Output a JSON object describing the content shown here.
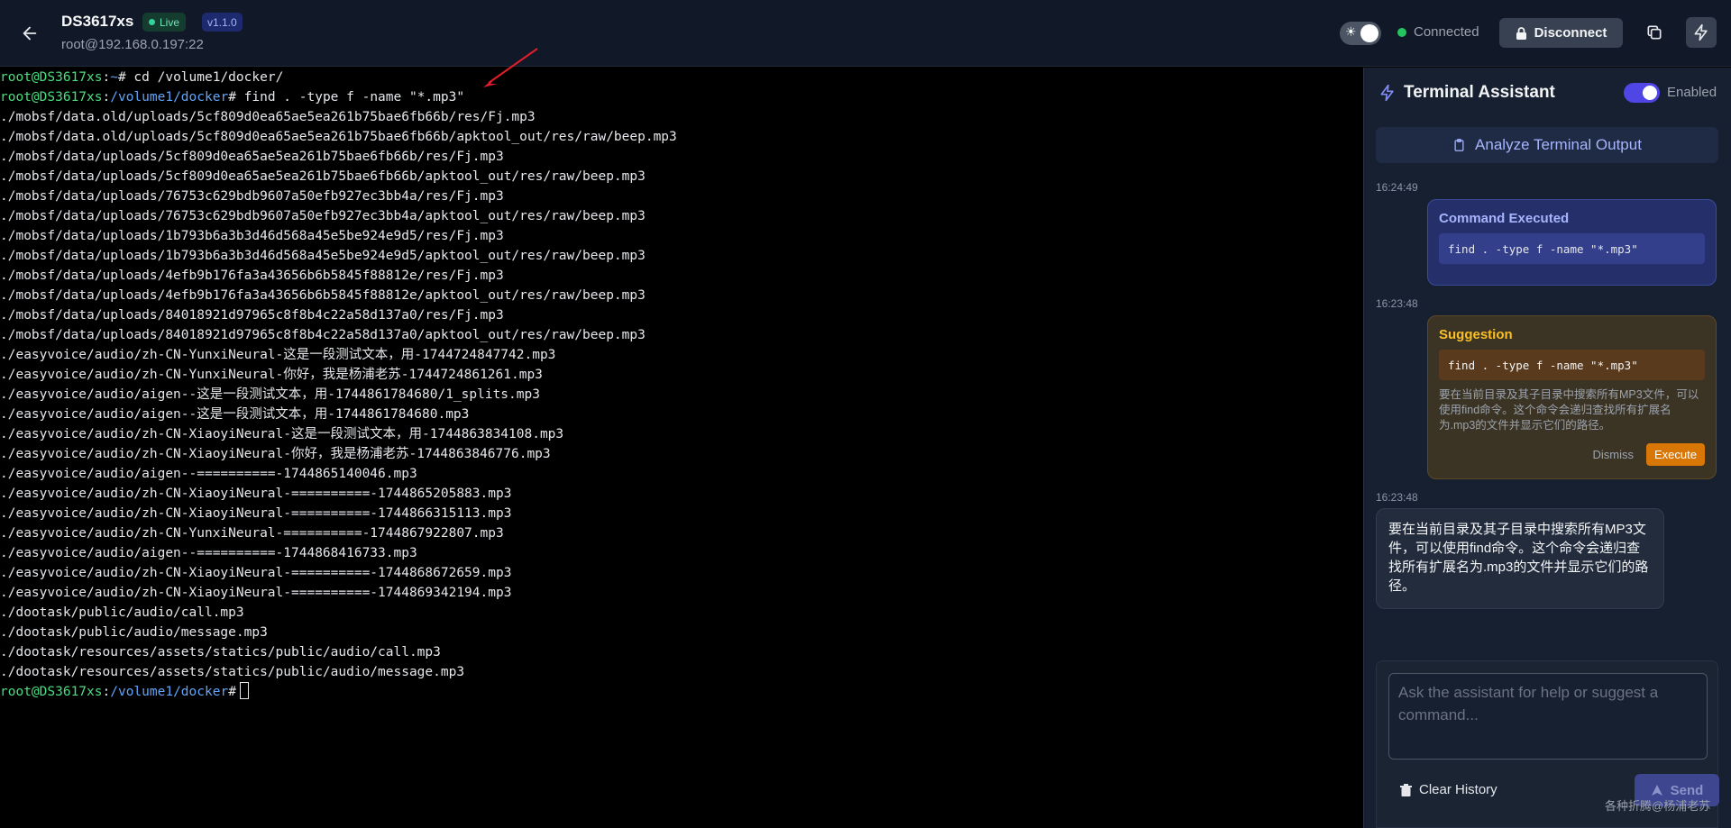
{
  "header": {
    "back_icon": "arrow-left-icon",
    "title": "DS3617xs",
    "live_label": "Live",
    "version": "v1.1.0",
    "subtitle": "root@192.168.0.197:22",
    "theme_icon": "sun-icon",
    "status": "Connected",
    "status_color": "#22c55e",
    "disconnect_label": "Disconnect",
    "copy_icon": "copy-icon",
    "bolt_icon": "bolt-icon"
  },
  "terminal": {
    "user_host": "root@DS3617xs",
    "line1_sep": ":",
    "line1_path": "~",
    "line1_cmd": "# cd /volume1/docker/",
    "line2_sep": ":",
    "line2_path": "/volume1/docker",
    "line2_cmd": "# find . -type f -name \"*.mp3\"",
    "output": [
      "./mobsf/data.old/uploads/5cf809d0ea65ae5ea261b75bae6fb66b/res/Fj.mp3",
      "./mobsf/data.old/uploads/5cf809d0ea65ae5ea261b75bae6fb66b/apktool_out/res/raw/beep.mp3",
      "./mobsf/data/uploads/5cf809d0ea65ae5ea261b75bae6fb66b/res/Fj.mp3",
      "./mobsf/data/uploads/5cf809d0ea65ae5ea261b75bae6fb66b/apktool_out/res/raw/beep.mp3",
      "./mobsf/data/uploads/76753c629bdb9607a50efb927ec3bb4a/res/Fj.mp3",
      "./mobsf/data/uploads/76753c629bdb9607a50efb927ec3bb4a/apktool_out/res/raw/beep.mp3",
      "./mobsf/data/uploads/1b793b6a3b3d46d568a45e5be924e9d5/res/Fj.mp3",
      "./mobsf/data/uploads/1b793b6a3b3d46d568a45e5be924e9d5/apktool_out/res/raw/beep.mp3",
      "./mobsf/data/uploads/4efb9b176fa3a43656b6b5845f88812e/res/Fj.mp3",
      "./mobsf/data/uploads/4efb9b176fa3a43656b6b5845f88812e/apktool_out/res/raw/beep.mp3",
      "./mobsf/data/uploads/84018921d97965c8f8b4c22a58d137a0/res/Fj.mp3",
      "./mobsf/data/uploads/84018921d97965c8f8b4c22a58d137a0/apktool_out/res/raw/beep.mp3",
      "./easyvoice/audio/zh-CN-YunxiNeural-这是一段测试文本，用-1744724847742.mp3",
      "./easyvoice/audio/zh-CN-YunxiNeural-你好，我是杨浦老苏-1744724861261.mp3",
      "./easyvoice/audio/aigen--这是一段测试文本，用-1744861784680/1_splits.mp3",
      "./easyvoice/audio/aigen--这是一段测试文本，用-1744861784680.mp3",
      "./easyvoice/audio/zh-CN-XiaoyiNeural-这是一段测试文本，用-1744863834108.mp3",
      "./easyvoice/audio/zh-CN-XiaoyiNeural-你好，我是杨浦老苏-1744863846776.mp3",
      "./easyvoice/audio/aigen--==========-1744865140046.mp3",
      "./easyvoice/audio/zh-CN-XiaoyiNeural-==========-1744865205883.mp3",
      "./easyvoice/audio/zh-CN-XiaoyiNeural-==========-1744866315113.mp3",
      "./easyvoice/audio/zh-CN-YunxiNeural-==========-1744867922807.mp3",
      "./easyvoice/audio/aigen--==========-1744868416733.mp3",
      "./easyvoice/audio/zh-CN-XiaoyiNeural-==========-1744868672659.mp3",
      "./easyvoice/audio/zh-CN-XiaoyiNeural-==========-1744869342194.mp3",
      "./dootask/public/audio/call.mp3",
      "./dootask/public/audio/message.mp3",
      "./dootask/resources/assets/statics/public/audio/call.mp3",
      "./dootask/resources/assets/statics/public/audio/message.mp3"
    ],
    "last_sep": ":",
    "last_path": "/volume1/docker",
    "last_cmd": "#"
  },
  "assistant": {
    "title": "Terminal Assistant",
    "enabled_label": "Enabled",
    "analyze_label": "Analyze Terminal Output",
    "cmd_time": "16:24:49",
    "cmd_title": "Command Executed",
    "cmd_code": "find . -type f -name \"*.mp3\"",
    "sug_time": "16:23:48",
    "sug_title": "Suggestion",
    "sug_code": "find . -type f -name \"*.mp3\"",
    "sug_desc": "要在当前目录及其子目录中搜索所有MP3文件，可以使用find命令。这个命令会递归查找所有扩展名为.mp3的文件并显示它们的路径。",
    "dismiss_label": "Dismiss",
    "execute_label": "Execute",
    "msg_time": "16:23:48",
    "msg_text": "要在当前目录及其子目录中搜索所有MP3文件，可以使用find命令。这个命令会递归查找所有扩展名为.mp3的文件并显示它们的路径。",
    "input_placeholder": "Ask the assistant for help or suggest a command...",
    "clear_label": "Clear History",
    "send_label": "Send"
  },
  "watermark": "各种折腾@杨浦老苏",
  "colors": {
    "accent": "#4f46e5",
    "suggestion": "#d97706",
    "prompt_user": "#4ade80",
    "prompt_path": "#60a5fa"
  }
}
